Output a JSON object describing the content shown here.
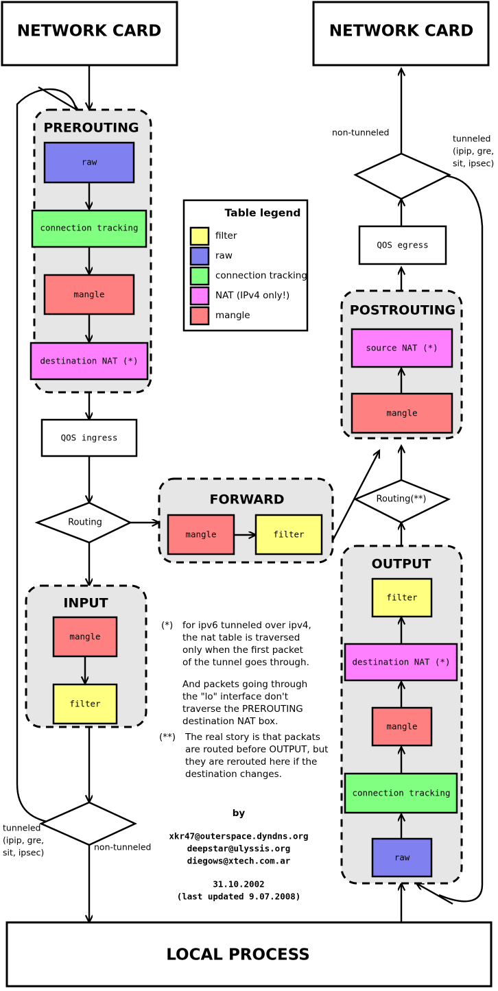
{
  "title": "Netfilter / iptables packet flow diagram",
  "endpoints": {
    "network_card_in": "NETWORK CARD",
    "network_card_out": "NETWORK CARD",
    "local_process": "LOCAL PROCESS"
  },
  "colors": {
    "filter": "#ffff80",
    "raw": "#8080f0",
    "conntrack": "#80ff80",
    "nat": "#ff80ff",
    "mangle": "#ff8080",
    "chain_bg": "#e6e6e6",
    "stroke": "#000000",
    "page_bg": "#ffffff"
  },
  "legend": {
    "title": "Table legend",
    "items": [
      {
        "label": "filter",
        "color": "#ffff80"
      },
      {
        "label": "raw",
        "color": "#8080f0"
      },
      {
        "label": "connection tracking",
        "color": "#80ff80"
      },
      {
        "label": "NAT  (IPv4 only!)",
        "color": "#ff80ff"
      },
      {
        "label": "mangle",
        "color": "#ff8080"
      }
    ]
  },
  "chains": {
    "prerouting": {
      "title": "PREROUTING",
      "tables": [
        {
          "label": "raw",
          "color": "#8080f0"
        },
        {
          "label": "connection tracking",
          "color": "#80ff80"
        },
        {
          "label": "mangle",
          "color": "#ff8080"
        },
        {
          "label": "destination NAT (*)",
          "color": "#ff80ff"
        }
      ]
    },
    "forward": {
      "title": "FORWARD",
      "tables": [
        {
          "label": "mangle",
          "color": "#ff8080"
        },
        {
          "label": "filter",
          "color": "#ffff80"
        }
      ]
    },
    "input": {
      "title": "INPUT",
      "tables": [
        {
          "label": "mangle",
          "color": "#ff8080"
        },
        {
          "label": "filter",
          "color": "#ffff80"
        }
      ]
    },
    "output": {
      "title": "OUTPUT",
      "tables": [
        {
          "label": "filter",
          "color": "#ffff80"
        },
        {
          "label": "destination NAT (*)",
          "color": "#ff80ff"
        },
        {
          "label": "mangle",
          "color": "#ff8080"
        },
        {
          "label": "connection tracking",
          "color": "#80ff80"
        },
        {
          "label": "raw",
          "color": "#8080f0"
        }
      ]
    },
    "postrouting": {
      "title": "POSTROUTING",
      "tables": [
        {
          "label": "source NAT (*)",
          "color": "#ff80ff"
        },
        {
          "label": "mangle",
          "color": "#ff8080"
        }
      ]
    }
  },
  "qos": {
    "ingress": "QOS ingress",
    "egress": "QOS egress"
  },
  "decisions": {
    "routing_in": "Routing",
    "routing_out": "Routing(**)",
    "tunnel_in": "",
    "tunnel_out": ""
  },
  "edge_labels": {
    "top_non_tunneled": "non-tunneled",
    "top_tunneled_1": "tunneled",
    "top_tunneled_2": "(ipip, gre,",
    "top_tunneled_3": "sit, ipsec)",
    "bottom_tunneled_1": "tunneled",
    "bottom_tunneled_2": "(ipip, gre,",
    "bottom_tunneled_3": "sit, ipsec)",
    "bottom_non_tunneled": "non-tunneled"
  },
  "notes": {
    "star_marker": "(*)",
    "star_lines": [
      "for ipv6 tunneled over ipv4,",
      "the nat table is traversed",
      "only when the first packet",
      "of the tunnel goes through.",
      "",
      "And packets going through",
      "the \"lo\" interface don't",
      "traverse the PREROUTING",
      "destination NAT box."
    ],
    "doublestar_marker": "(**)",
    "doublestar_lines": [
      "The real story is that packats",
      "are routed before OUTPUT, but",
      "they are rerouted here if the",
      "destination changes."
    ]
  },
  "credits": {
    "by": "by",
    "authors": [
      "xkr47@outerspace.dyndns.org",
      "deepstar@ulyssis.org",
      "diegows@xtech.com.ar"
    ],
    "date": "31.10.2002",
    "updated": "(last updated 9.07.2008)"
  }
}
